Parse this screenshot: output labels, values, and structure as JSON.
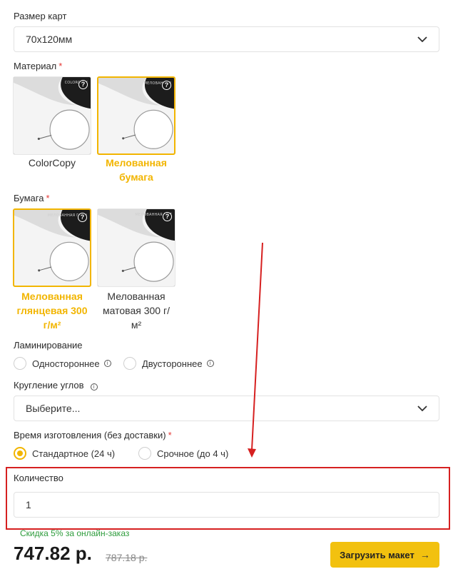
{
  "card_size": {
    "label": "Размер карт",
    "selected": "70x120мм"
  },
  "material": {
    "label": "Материал",
    "required_mark": "*",
    "options": [
      {
        "label": "ColorCopy",
        "brand": "COLORCOPY",
        "selected": false
      },
      {
        "label": "Мелованная бумага",
        "brand": "МЕЛОВАННАЯ",
        "selected": true
      }
    ]
  },
  "paper": {
    "label": "Бумага",
    "required_mark": "*",
    "options": [
      {
        "label_line1": "Мелованная",
        "label_line2": "глянцевая 300",
        "label_line3": "г/м²",
        "brand": "МЕЛОВАННАЯ ГЛЯН",
        "selected": true
      },
      {
        "label_line1": "Мелованная",
        "label_line2": "матовая 300 г/",
        "label_line3": "м²",
        "brand": "МЕЛОВАННАЯ МАТ",
        "selected": false
      }
    ]
  },
  "lamination": {
    "label": "Ламинирование",
    "options": [
      {
        "label": "Одностороннее",
        "checked": false
      },
      {
        "label": "Двустороннее",
        "checked": false
      }
    ]
  },
  "corner_rounding": {
    "label": "Кругление углов",
    "placeholder": "Выберите..."
  },
  "production_time": {
    "label": "Время изготовления (без доставки)",
    "required_mark": "*",
    "options": [
      {
        "label": "Стандартное (24 ч)",
        "checked": true
      },
      {
        "label": "Срочное (до 4 ч)",
        "checked": false
      }
    ]
  },
  "quantity": {
    "label": "Количество",
    "value": "1"
  },
  "pricing": {
    "discount_note": "Скидка 5% за онлайн-заказ",
    "price": "747.82 р.",
    "old_price": "787.18 р."
  },
  "upload_button": {
    "label": "Загрузить макет",
    "icon": "arrow-right-icon"
  },
  "colors": {
    "accent": "#f2b500",
    "button": "#f2c10f",
    "highlight_box": "#d62020",
    "discount": "#2e9c3c"
  }
}
